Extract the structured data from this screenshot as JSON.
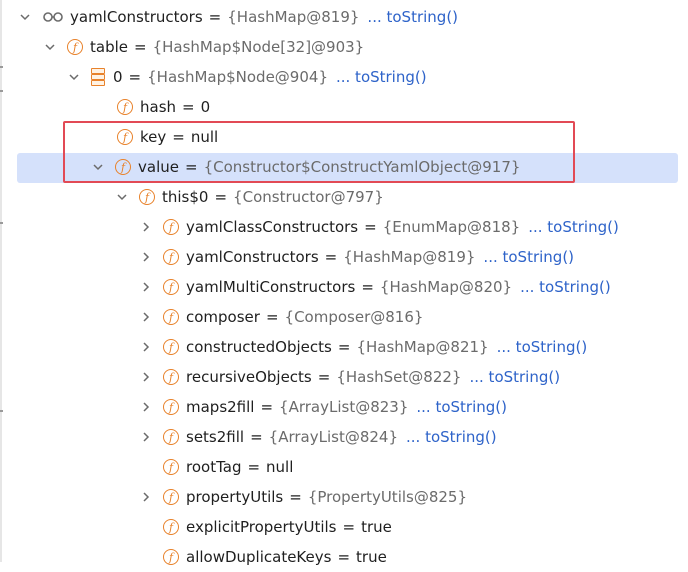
{
  "rows": [
    {
      "name": "yamlConstructors",
      "value": "{HashMap@819}",
      "link": "... toString()"
    },
    {
      "name": "table",
      "value": "{HashMap$Node[32]@903}"
    },
    {
      "name": "0",
      "value": "{HashMap$Node@904}",
      "link": "... toString()"
    },
    {
      "name": "hash",
      "value": "0"
    },
    {
      "name": "key",
      "value": "null"
    },
    {
      "name": "value",
      "value": "{Constructor$ConstructYamlObject@917}"
    },
    {
      "name": "this$0",
      "value": "{Constructor@797}"
    },
    {
      "name": "yamlClassConstructors",
      "value": "{EnumMap@818}",
      "link": "... toString()"
    },
    {
      "name": "yamlConstructors",
      "value": "{HashMap@819}",
      "link": "... toString()"
    },
    {
      "name": "yamlMultiConstructors",
      "value": "{HashMap@820}",
      "link": "... toString()"
    },
    {
      "name": "composer",
      "value": "{Composer@816}"
    },
    {
      "name": "constructedObjects",
      "value": "{HashMap@821}",
      "link": "... toString()"
    },
    {
      "name": "recursiveObjects",
      "value": "{HashSet@822}",
      "link": "... toString()"
    },
    {
      "name": "maps2fill",
      "value": "{ArrayList@823}",
      "link": "... toString()"
    },
    {
      "name": "sets2fill",
      "value": "{ArrayList@824}",
      "link": "... toString()"
    },
    {
      "name": "rootTag",
      "value": "null"
    },
    {
      "name": "propertyUtils",
      "value": "{PropertyUtils@825}"
    },
    {
      "name": "explicitPropertyUtils",
      "value": "true"
    },
    {
      "name": "allowDuplicateKeys",
      "value": "true"
    }
  ],
  "field_icon_letter": "f",
  "equals_sign": "=",
  "colors": {
    "accent": "#e8822b",
    "link": "#2e63c9",
    "selection": "#d5e1fb",
    "highlight_box": "#e24a55"
  },
  "icons": {
    "watch": "glasses-icon",
    "array": "array-stack-icon",
    "field": "field-icon",
    "expanded": "chevron-down-icon",
    "collapsed": "chevron-right-icon"
  }
}
